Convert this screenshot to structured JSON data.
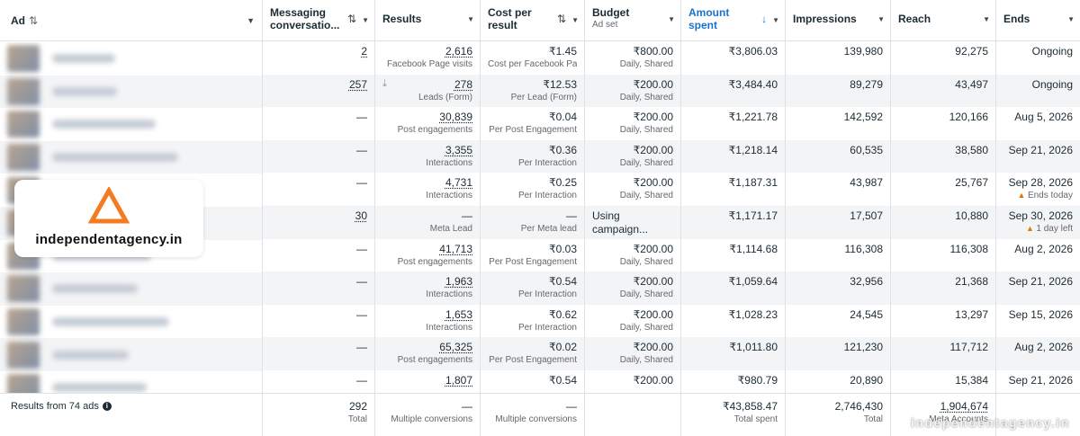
{
  "ad_column": {
    "label": "Ad",
    "sort_icon": "sort-icon",
    "dropdown_icon": "chevron-down-icon"
  },
  "footer": {
    "label": "Results from 74 ads"
  },
  "watermark": {
    "brand": "independentagency.in",
    "bottom": "independentagency.in"
  },
  "columns": [
    {
      "key": "msg",
      "label": "Messaging conversatio...",
      "sub": ""
    },
    {
      "key": "res",
      "label": "Results",
      "sub": ""
    },
    {
      "key": "cpr",
      "label": "Cost per result",
      "sub": ""
    },
    {
      "key": "bud",
      "label": "Budget",
      "sub": "Ad set"
    },
    {
      "key": "amt",
      "label": "Amount spent",
      "sub": ""
    },
    {
      "key": "imp",
      "label": "Impressions",
      "sub": ""
    },
    {
      "key": "rea",
      "label": "Reach",
      "sub": ""
    },
    {
      "key": "end",
      "label": "Ends",
      "sub": ""
    }
  ],
  "rows": [
    {
      "msg": "2",
      "res": "2,616",
      "res_sub": "Facebook Page visits",
      "cpr": "₹1.45",
      "cpr_sub": "Cost per Facebook Pa...",
      "bud": "₹800.00",
      "bud_sub": "Daily, Shared",
      "amt": "₹3,806.03",
      "imp": "139,980",
      "rea": "92,275",
      "end": "Ongoing",
      "end_sub": ""
    },
    {
      "msg": "257",
      "res": "278",
      "res_sub": "Leads (Form)",
      "cpr": "₹12.53",
      "cpr_sub": "Per Lead (Form)",
      "bud": "₹200.00",
      "bud_sub": "Daily, Shared",
      "amt": "₹3,484.40",
      "imp": "89,279",
      "rea": "43,497",
      "end": "Ongoing",
      "end_sub": ""
    },
    {
      "msg": "—",
      "res": "30,839",
      "res_sub": "Post engagements",
      "cpr": "₹0.04",
      "cpr_sub": "Per Post Engagement",
      "bud": "₹200.00",
      "bud_sub": "Daily, Shared",
      "amt": "₹1,221.78",
      "imp": "142,592",
      "rea": "120,166",
      "end": "Aug 5, 2026",
      "end_sub": ""
    },
    {
      "msg": "—",
      "res": "3,355",
      "res_sub": "Interactions",
      "cpr": "₹0.36",
      "cpr_sub": "Per Interaction",
      "bud": "₹200.00",
      "bud_sub": "Daily, Shared",
      "amt": "₹1,218.14",
      "imp": "60,535",
      "rea": "38,580",
      "end": "Sep 21, 2026",
      "end_sub": ""
    },
    {
      "msg": "—",
      "res": "4,731",
      "res_sub": "Interactions",
      "cpr": "₹0.25",
      "cpr_sub": "Per Interaction",
      "bud": "₹200.00",
      "bud_sub": "Daily, Shared",
      "amt": "₹1,187.31",
      "imp": "43,987",
      "rea": "25,767",
      "end": "Sep 28, 2026",
      "end_sub": "Ends today"
    },
    {
      "msg": "30",
      "res": "—",
      "res_sub": "Meta Lead",
      "cpr": "—",
      "cpr_sub": "Per Meta lead",
      "bud": "Using campaign...",
      "bud_sub": "",
      "amt": "₹1,171.17",
      "imp": "17,507",
      "rea": "10,880",
      "end": "Sep 30, 2026",
      "end_sub": "1 day left"
    },
    {
      "msg": "—",
      "res": "41,713",
      "res_sub": "Post engagements",
      "cpr": "₹0.03",
      "cpr_sub": "Per Post Engagement",
      "bud": "₹200.00",
      "bud_sub": "Daily, Shared",
      "amt": "₹1,114.68",
      "imp": "116,308",
      "rea": "116,308",
      "end": "Aug 2, 2026",
      "end_sub": ""
    },
    {
      "msg": "—",
      "res": "1,963",
      "res_sub": "Interactions",
      "cpr": "₹0.54",
      "cpr_sub": "Per Interaction",
      "bud": "₹200.00",
      "bud_sub": "Daily, Shared",
      "amt": "₹1,059.64",
      "imp": "32,956",
      "rea": "21,368",
      "end": "Sep 21, 2026",
      "end_sub": ""
    },
    {
      "msg": "—",
      "res": "1,653",
      "res_sub": "Interactions",
      "cpr": "₹0.62",
      "cpr_sub": "Per Interaction",
      "bud": "₹200.00",
      "bud_sub": "Daily, Shared",
      "amt": "₹1,028.23",
      "imp": "24,545",
      "rea": "13,297",
      "end": "Sep 15, 2026",
      "end_sub": ""
    },
    {
      "msg": "—",
      "res": "65,325",
      "res_sub": "Post engagements",
      "cpr": "₹0.02",
      "cpr_sub": "Per Post Engagement",
      "bud": "₹200.00",
      "bud_sub": "Daily, Shared",
      "amt": "₹1,011.80",
      "imp": "121,230",
      "rea": "117,712",
      "end": "Aug 2, 2026",
      "end_sub": ""
    },
    {
      "msg": "—",
      "res": "1,807",
      "res_sub": "",
      "cpr": "₹0.54",
      "cpr_sub": "",
      "bud": "₹200.00",
      "bud_sub": "",
      "amt": "₹980.79",
      "imp": "20,890",
      "rea": "15,384",
      "end": "Sep 21, 2026",
      "end_sub": ""
    }
  ],
  "totals": {
    "msg": "292",
    "msg_sub": "Total",
    "res": "—",
    "res_sub": "Multiple conversions",
    "cpr": "—",
    "cpr_sub": "Multiple conversions",
    "bud": "",
    "bud_sub": "",
    "amt": "₹43,858.47",
    "amt_sub": "Total spent",
    "imp": "2,746,430",
    "imp_sub": "Total",
    "rea": "1,904,674",
    "rea_sub": "Meta Accounts",
    "end": "",
    "end_sub": ""
  },
  "colors": {
    "accent_blue": "#1a73c8",
    "warning": "#e0790b",
    "brand_orange": "#f47b20"
  }
}
